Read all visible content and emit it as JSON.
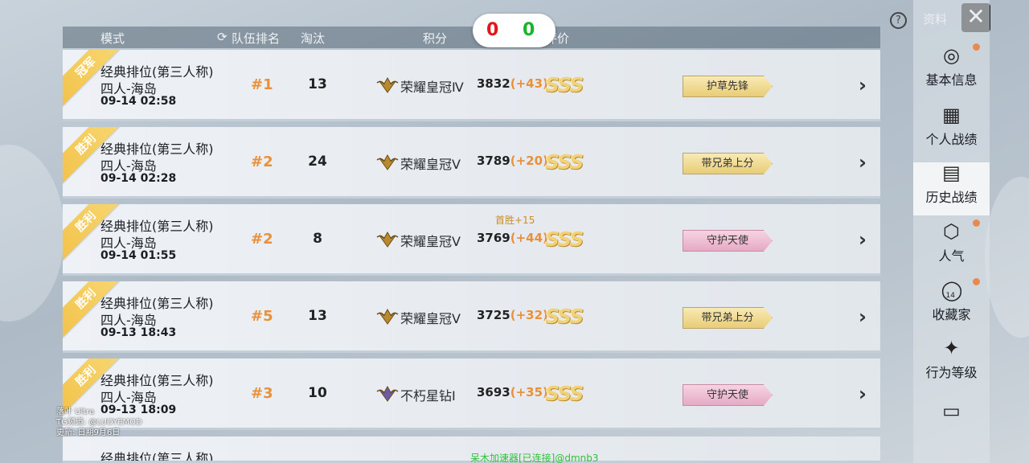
{
  "header": {
    "mode": "模式",
    "team_rank": "队伍排名",
    "kills": "淘汰",
    "score": "积分",
    "rating": "评价"
  },
  "score_pill": {
    "red": "0",
    "green": "0"
  },
  "rows": [
    {
      "ribbon": "冠军",
      "mode": "经典排位(第三人称)",
      "map": "四人-海岛",
      "date": "09-14 02:58",
      "rank": "#1",
      "kills": "13",
      "tier": "荣耀皇冠Ⅳ",
      "tier_icon": "crown-wings-icon",
      "points": "3832",
      "delta": "(+43)",
      "bonus": "",
      "grade": "SSS",
      "tag": "护草先锋",
      "tag_color": "gold"
    },
    {
      "ribbon": "胜利",
      "mode": "经典排位(第三人称)",
      "map": "四人-海岛",
      "date": "09-14 02:28",
      "rank": "#2",
      "kills": "24",
      "tier": "荣耀皇冠Ⅴ",
      "tier_icon": "crown-wings-icon",
      "points": "3789",
      "delta": "(+20)",
      "bonus": "",
      "grade": "SSS",
      "tag": "带兄弟上分",
      "tag_color": "gold"
    },
    {
      "ribbon": "胜利",
      "mode": "经典排位(第三人称)",
      "map": "四人-海岛",
      "date": "09-14 01:55",
      "rank": "#2",
      "kills": "8",
      "tier": "荣耀皇冠Ⅴ",
      "tier_icon": "crown-wings-icon",
      "points": "3769",
      "delta": "(+44)",
      "bonus": "首胜+15",
      "grade": "SSS",
      "tag": "守护天使",
      "tag_color": "pink"
    },
    {
      "ribbon": "胜利",
      "mode": "经典排位(第三人称)",
      "map": "四人-海岛",
      "date": "09-13 18:43",
      "rank": "#5",
      "kills": "13",
      "tier": "荣耀皇冠Ⅴ",
      "tier_icon": "crown-wings-icon",
      "points": "3725",
      "delta": "(+32)",
      "bonus": "",
      "grade": "SSS",
      "tag": "带兄弟上分",
      "tag_color": "gold"
    },
    {
      "ribbon": "胜利",
      "mode": "经典排位(第三人称)",
      "map": "四人-海岛",
      "date": "09-13 18:09",
      "rank": "#3",
      "kills": "10",
      "tier": "不朽星钻Ⅰ",
      "tier_icon": "diamond-star-icon",
      "points": "3693",
      "delta": "(+35)",
      "bonus": "",
      "grade": "SSS",
      "tag": "守护天使",
      "tag_color": "pink"
    },
    {
      "ribbon": "",
      "mode": "经典排位(第三人称)",
      "map": "",
      "date": "",
      "rank": "",
      "kills": "",
      "tier": "",
      "tier_icon": "",
      "points": "",
      "delta": "",
      "bonus": "",
      "grade": "",
      "tag": "",
      "tag_color": ""
    }
  ],
  "sidebar": {
    "top_label": "资料",
    "items": [
      {
        "label": "基本信息",
        "icon": "user-info-icon",
        "dot": true,
        "active": false
      },
      {
        "label": "个人战绩",
        "icon": "chart-icon",
        "dot": false,
        "active": false
      },
      {
        "label": "历史战绩",
        "icon": "history-icon",
        "dot": false,
        "active": true
      },
      {
        "label": "人气",
        "icon": "popularity-icon",
        "dot": true,
        "active": false
      },
      {
        "label": "收藏家",
        "icon": "collector-icon",
        "dot": true,
        "active": false
      },
      {
        "label": "行为等级",
        "icon": "behavior-icon",
        "dot": false,
        "active": false
      },
      {
        "label": "",
        "icon": "note-icon",
        "dot": false,
        "active": false
      }
    ],
    "collector_badge": "14"
  },
  "watermark": {
    "line1": "落叶 Ultra",
    "line2": "TG频道: @LUOYEMOD",
    "line3": "更新: 日期9月6日"
  },
  "footer": "呆木加速器[已连接]@dmnb3"
}
